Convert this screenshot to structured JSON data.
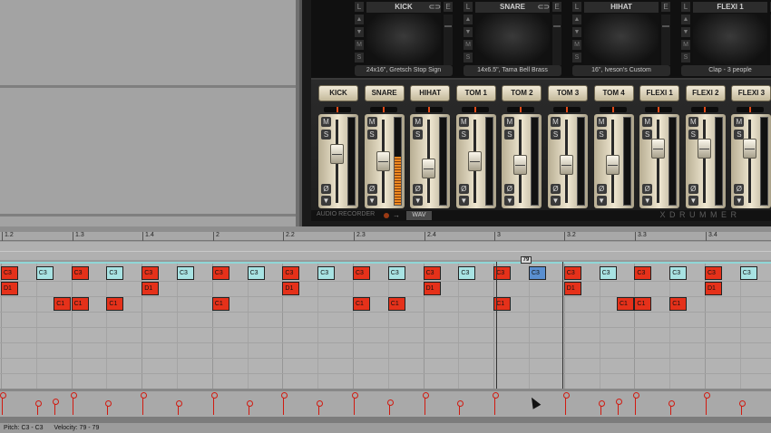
{
  "kit_slots": [
    {
      "label": "KICK",
      "name": "24x16\", Gretsch Stop Sign",
      "has_link": true
    },
    {
      "label": "SNARE",
      "name": "14x6.5\", Tama Bell Brass",
      "has_link": true
    },
    {
      "label": "HIHAT",
      "name": "16\", Iveson's Custom",
      "has_link": false
    },
    {
      "label": "FLEXI 1",
      "name": "Clap - 3 people",
      "has_link": false
    }
  ],
  "slot_buttons": {
    "l": "L",
    "e": "E",
    "m": "M",
    "s": "S"
  },
  "mixer_channels": [
    {
      "label": "KICK",
      "level": 0.62
    },
    {
      "label": "SNARE",
      "level": 0.5
    },
    {
      "label": "HIHAT",
      "level": 0.38
    },
    {
      "label": "TOM 1",
      "level": 0.5
    },
    {
      "label": "TOM 2",
      "level": 0.45
    },
    {
      "label": "TOM 3",
      "level": 0.45
    },
    {
      "label": "TOM 4",
      "level": 0.45
    },
    {
      "label": "FLEXI 1",
      "level": 0.7
    },
    {
      "label": "FLEXI 2",
      "level": 0.7
    },
    {
      "label": "FLEXI 3",
      "level": 0.7
    }
  ],
  "channel_buttons": {
    "mute": "M",
    "solo": "S",
    "phase": "Ø",
    "down": "▼"
  },
  "recorder": {
    "label": "AUDIO RECORDER",
    "format": "WAV",
    "brand": "X D R U M M E R"
  },
  "ruler": [
    {
      "label": "1.2",
      "pos": 2
    },
    {
      "label": "1.3",
      "pos": 80
    },
    {
      "label": "1.4",
      "pos": 157
    },
    {
      "label": "2",
      "pos": 235
    },
    {
      "label": "2.2",
      "pos": 312
    },
    {
      "label": "2.3",
      "pos": 390
    },
    {
      "label": "2.4",
      "pos": 468
    },
    {
      "label": "3",
      "pos": 545
    },
    {
      "label": "3.2",
      "pos": 622
    },
    {
      "label": "3.3",
      "pos": 700
    },
    {
      "label": "3.4",
      "pos": 778
    }
  ],
  "marker_value": "79",
  "notes": [
    {
      "pitch": "C3",
      "color": "red",
      "beat": 0,
      "row": 0
    },
    {
      "pitch": "C3",
      "color": "cyan",
      "beat": 0.5,
      "row": 0
    },
    {
      "pitch": "C3",
      "color": "red",
      "beat": 1,
      "row": 0
    },
    {
      "pitch": "C3",
      "color": "cyan",
      "beat": 1.5,
      "row": 0
    },
    {
      "pitch": "C3",
      "color": "red",
      "beat": 2,
      "row": 0
    },
    {
      "pitch": "C3",
      "color": "cyan",
      "beat": 2.5,
      "row": 0
    },
    {
      "pitch": "C3",
      "color": "red",
      "beat": 3,
      "row": 0
    },
    {
      "pitch": "C3",
      "color": "cyan",
      "beat": 3.5,
      "row": 0
    },
    {
      "pitch": "C3",
      "color": "red",
      "beat": 4,
      "row": 0
    },
    {
      "pitch": "C3",
      "color": "cyan",
      "beat": 4.5,
      "row": 0
    },
    {
      "pitch": "C3",
      "color": "red",
      "beat": 5,
      "row": 0
    },
    {
      "pitch": "C3",
      "color": "cyan",
      "beat": 5.5,
      "row": 0
    },
    {
      "pitch": "C3",
      "color": "red",
      "beat": 6,
      "row": 0
    },
    {
      "pitch": "C3",
      "color": "cyan",
      "beat": 6.5,
      "row": 0
    },
    {
      "pitch": "C3",
      "color": "red",
      "beat": 7,
      "row": 0
    },
    {
      "pitch": "C3",
      "color": "sel",
      "beat": 7.5,
      "row": 0
    },
    {
      "pitch": "C3",
      "color": "red",
      "beat": 8,
      "row": 0
    },
    {
      "pitch": "C3",
      "color": "cyan",
      "beat": 8.5,
      "row": 0
    },
    {
      "pitch": "C3",
      "color": "red",
      "beat": 9,
      "row": 0
    },
    {
      "pitch": "C3",
      "color": "cyan",
      "beat": 9.5,
      "row": 0
    },
    {
      "pitch": "C3",
      "color": "red",
      "beat": 10,
      "row": 0
    },
    {
      "pitch": "C3",
      "color": "cyan",
      "beat": 10.5,
      "row": 0
    },
    {
      "pitch": "D1",
      "color": "red",
      "beat": 0,
      "row": 1
    },
    {
      "pitch": "D1",
      "color": "red",
      "beat": 2,
      "row": 1
    },
    {
      "pitch": "D1",
      "color": "red",
      "beat": 4,
      "row": 1
    },
    {
      "pitch": "D1",
      "color": "red",
      "beat": 6,
      "row": 1
    },
    {
      "pitch": "D1",
      "color": "red",
      "beat": 8,
      "row": 1
    },
    {
      "pitch": "D1",
      "color": "red",
      "beat": 10,
      "row": 1
    },
    {
      "pitch": "C1",
      "color": "red",
      "beat": 0.75,
      "row": 2
    },
    {
      "pitch": "C1",
      "color": "red",
      "beat": 1,
      "row": 2
    },
    {
      "pitch": "C1",
      "color": "red",
      "beat": 1.5,
      "row": 2
    },
    {
      "pitch": "C1",
      "color": "red",
      "beat": 3,
      "row": 2
    },
    {
      "pitch": "C1",
      "color": "red",
      "beat": 5,
      "row": 2
    },
    {
      "pitch": "C1",
      "color": "red",
      "beat": 5.5,
      "row": 2
    },
    {
      "pitch": "C1",
      "color": "red",
      "beat": 7,
      "row": 2
    },
    {
      "pitch": "C1",
      "color": "red",
      "beat": 8.75,
      "row": 2
    },
    {
      "pitch": "C1",
      "color": "red",
      "beat": 9,
      "row": 2
    },
    {
      "pitch": "C1",
      "color": "red",
      "beat": 9.5,
      "row": 2
    }
  ],
  "velocities": [
    {
      "beat": 0,
      "value": 1.0
    },
    {
      "beat": 0.5,
      "value": 0.6
    },
    {
      "beat": 0.75,
      "value": 0.7
    },
    {
      "beat": 1,
      "value": 1.0
    },
    {
      "beat": 1.5,
      "value": 0.6
    },
    {
      "beat": 2,
      "value": 1.0
    },
    {
      "beat": 2.5,
      "value": 0.6
    },
    {
      "beat": 3,
      "value": 1.0
    },
    {
      "beat": 3.5,
      "value": 0.6
    },
    {
      "beat": 4,
      "value": 1.0
    },
    {
      "beat": 4.5,
      "value": 0.6
    },
    {
      "beat": 5,
      "value": 1.0
    },
    {
      "beat": 5.5,
      "value": 0.65
    },
    {
      "beat": 6,
      "value": 1.0
    },
    {
      "beat": 6.5,
      "value": 0.6
    },
    {
      "beat": 7,
      "value": 1.0
    },
    {
      "beat": 8,
      "value": 1.0
    },
    {
      "beat": 8.5,
      "value": 0.6
    },
    {
      "beat": 8.75,
      "value": 0.7
    },
    {
      "beat": 9,
      "value": 1.0
    },
    {
      "beat": 9.5,
      "value": 0.6
    },
    {
      "beat": 10,
      "value": 1.0
    },
    {
      "beat": 10.5,
      "value": 0.6
    }
  ],
  "status": {
    "pitch": "Pitch: C3 - C3",
    "velocity": "Velocity: 79 - 79"
  }
}
